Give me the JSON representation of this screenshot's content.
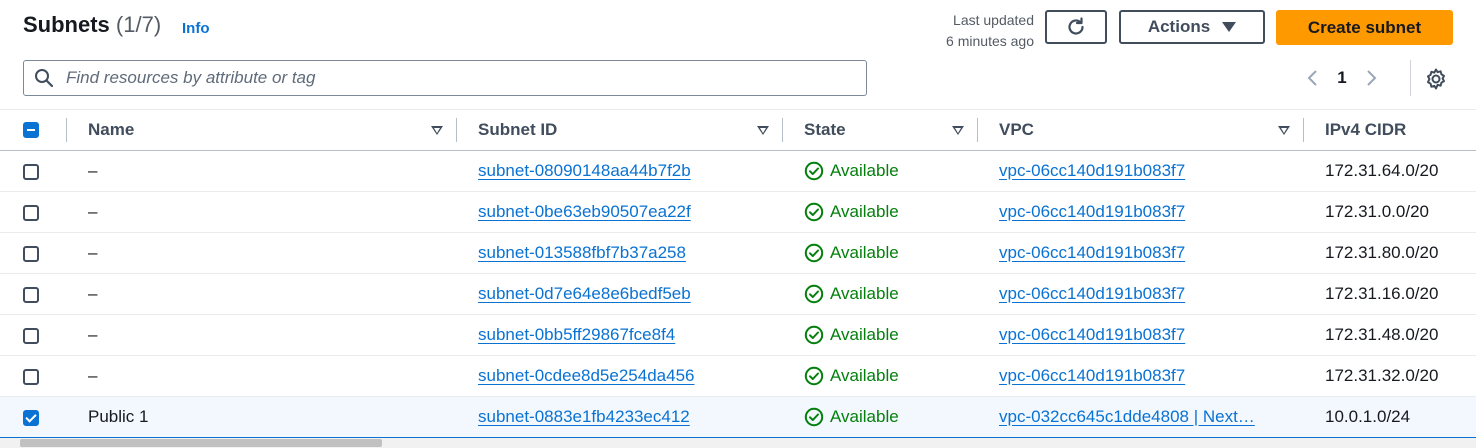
{
  "header": {
    "title": "Subnets",
    "count": "(1/7)",
    "info_label": "Info",
    "last_updated_line1": "Last updated",
    "last_updated_line2": "6 minutes ago",
    "actions_label": "Actions",
    "create_label": "Create subnet"
  },
  "search": {
    "placeholder": "Find resources by attribute or tag",
    "value": ""
  },
  "pagination": {
    "current_page": "1"
  },
  "table": {
    "columns": [
      "Name",
      "Subnet ID",
      "State",
      "VPC",
      "IPv4 CIDR"
    ],
    "rows": [
      {
        "name": "–",
        "subnet_id": "subnet-08090148aa44b7f2b",
        "state": "Available",
        "vpc": "vpc-06cc140d191b083f7",
        "cidr": "172.31.64.0/20",
        "selected": false
      },
      {
        "name": "–",
        "subnet_id": "subnet-0be63eb90507ea22f",
        "state": "Available",
        "vpc": "vpc-06cc140d191b083f7",
        "cidr": "172.31.0.0/20",
        "selected": false
      },
      {
        "name": "–",
        "subnet_id": "subnet-013588fbf7b37a258",
        "state": "Available",
        "vpc": "vpc-06cc140d191b083f7",
        "cidr": "172.31.80.0/20",
        "selected": false
      },
      {
        "name": "–",
        "subnet_id": "subnet-0d7e64e8e6bedf5eb",
        "state": "Available",
        "vpc": "vpc-06cc140d191b083f7",
        "cidr": "172.31.16.0/20",
        "selected": false
      },
      {
        "name": "–",
        "subnet_id": "subnet-0bb5ff29867fce8f4",
        "state": "Available",
        "vpc": "vpc-06cc140d191b083f7",
        "cidr": "172.31.48.0/20",
        "selected": false
      },
      {
        "name": "–",
        "subnet_id": "subnet-0cdee8d5e254da456",
        "state": "Available",
        "vpc": "vpc-06cc140d191b083f7",
        "cidr": "172.31.32.0/20",
        "selected": false
      },
      {
        "name": "Public 1",
        "subnet_id": "subnet-0883e1fb4233ec412",
        "state": "Available",
        "vpc": "vpc-032cc645c1dde4808 | Next…",
        "cidr": "10.0.1.0/24",
        "selected": true
      }
    ]
  },
  "colors": {
    "accent": "#0972d3",
    "primary_button": "#ff9900",
    "success": "#037f0c"
  },
  "icons": {
    "refresh": "refresh-icon",
    "actions_caret": "caret-down-icon",
    "search": "search-icon",
    "prev": "chevron-left-icon",
    "next": "chevron-right-icon",
    "settings": "gear-icon",
    "status": "check-circle-icon",
    "sort": "sort-caret-icon"
  }
}
